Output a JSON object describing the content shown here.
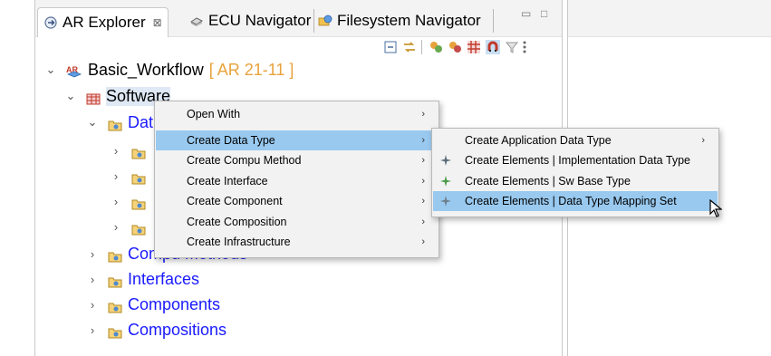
{
  "tabs": [
    {
      "label": "AR Explorer",
      "close": "⊠",
      "active": true
    },
    {
      "label": "ECU Navigator",
      "active": false
    },
    {
      "label": "Filesystem Navigator",
      "active": false
    }
  ],
  "window_buttons": {
    "minimize": "▭",
    "restore": "□"
  },
  "tree": {
    "root": {
      "label": "Basic_Workflow",
      "tag": "[ AR 21-11 ]"
    },
    "software": {
      "label": "Software"
    },
    "data_partial": "Dat",
    "compu_methods": "Compu Methods",
    "interfaces": "Interfaces",
    "components": "Components",
    "compositions": "Compositions"
  },
  "context_menu": {
    "items": [
      {
        "label": "Open With",
        "selected": false
      },
      {
        "label": "Create Data Type",
        "selected": true
      },
      {
        "label": "Create Compu Method",
        "selected": false
      },
      {
        "label": "Create Interface",
        "selected": false
      },
      {
        "label": "Create Component",
        "selected": false
      },
      {
        "label": "Create Composition",
        "selected": false
      },
      {
        "label": "Create Infrastructure",
        "selected": false
      }
    ]
  },
  "submenu": {
    "items": [
      {
        "label": "Create Application Data Type",
        "icon": "",
        "arrow": true,
        "selected": false
      },
      {
        "label": "Create Elements | Implementation Data Type",
        "icon": "sparkle-icon",
        "arrow": false,
        "selected": false
      },
      {
        "label": "Create Elements | Sw Base Type",
        "icon": "sparkle-icon",
        "arrow": false,
        "selected": false
      },
      {
        "label": "Create Elements | Data Type Mapping Set",
        "icon": "sparkle-icon",
        "arrow": false,
        "selected": true
      }
    ]
  },
  "colors": {
    "link": "#1a1aff",
    "tag": "#e8a23c",
    "selection": "#99c9ef",
    "menu_bg": "#f2f2f2"
  }
}
